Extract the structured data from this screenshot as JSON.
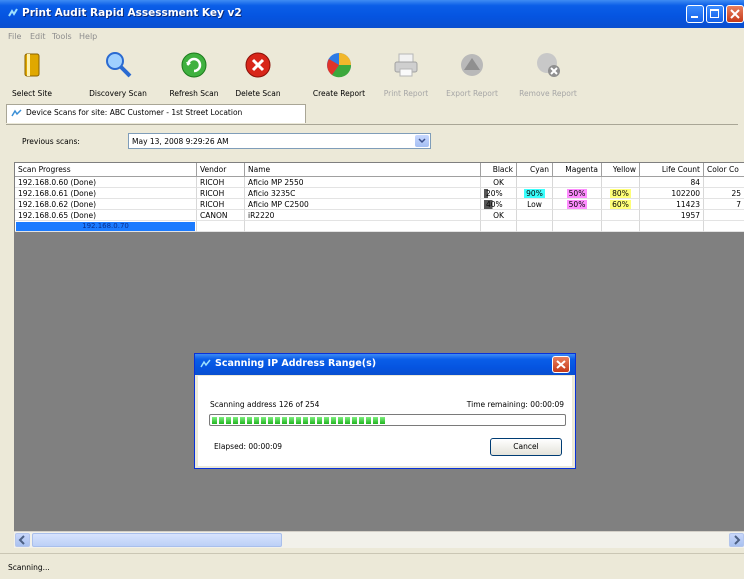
{
  "window": {
    "title": "Print Audit Rapid Assessment Key v2"
  },
  "menubar": {
    "items": [
      "File",
      "Edit",
      "Tools",
      "Help"
    ]
  },
  "toolbar": {
    "select_site": "Select Site",
    "discovery_scan": "Discovery Scan",
    "refresh_scan": "Refresh Scan",
    "delete_scan": "Delete Scan",
    "create_report": "Create Report",
    "print_report": "Print Report",
    "export_report": "Export Report",
    "remove_report": "Remove Report"
  },
  "site_tab": {
    "label": "Device Scans for site: ABC Customer - 1st Street Location"
  },
  "previous_scans": {
    "label": "Previous scans:",
    "value": "May 13, 2008 9:29:26 AM"
  },
  "grid": {
    "columns": [
      "Scan Progress",
      "Vendor",
      "Name",
      "Black",
      "Cyan",
      "Magenta",
      "Yellow",
      "Life Count",
      "Color Co"
    ],
    "rows": [
      {
        "progress": "192.168.0.60 (Done)",
        "vendor": "RICOH",
        "name": "Aficio MP 2550",
        "black": "OK",
        "cyan": "",
        "magenta": "",
        "yellow": "",
        "life": "84",
        "color": ""
      },
      {
        "progress": "192.168.0.61 (Done)",
        "vendor": "RICOH",
        "name": "Aficio 3235C",
        "black": "20%",
        "cyan": "90%",
        "magenta": "50%",
        "yellow": "80%",
        "life": "102200",
        "color": "25"
      },
      {
        "progress": "192.168.0.62 (Done)",
        "vendor": "RICOH",
        "name": "Aficio MP C2500",
        "black": "40%",
        "cyan": "Low",
        "magenta": "50%",
        "yellow": "60%",
        "life": "11423",
        "color": "7"
      },
      {
        "progress": "192.168.0.65 (Done)",
        "vendor": "CANON",
        "name": "iR2220",
        "black": "OK",
        "cyan": "",
        "magenta": "",
        "yellow": "",
        "life": "1957",
        "color": ""
      }
    ],
    "scanning_row": "192.168.0.70"
  },
  "status": {
    "text": "Scanning..."
  },
  "dialog": {
    "title": "Scanning IP Address Range(s)",
    "scanning": "Scanning address 126 of 254",
    "time_remaining": "Time remaining: 00:00:09",
    "elapsed": "Elapsed: 00:00:09",
    "cancel": "Cancel",
    "progress": 0.5
  }
}
